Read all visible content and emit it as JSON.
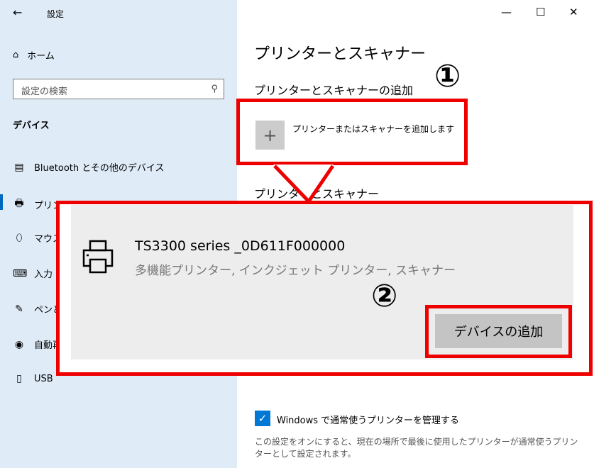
{
  "titlebar": {
    "back_icon": "arrow-left-icon",
    "title": "設定"
  },
  "window": {
    "minimize": "—",
    "maximize": "☐",
    "close": "✕"
  },
  "sidebar": {
    "home": "ホーム",
    "search_placeholder": "設定の検索",
    "section": "デバイス",
    "items": [
      {
        "label": "Bluetooth とその他のデバイス",
        "icon": "bluetooth-devices-icon"
      },
      {
        "label": "プリンターとスキャナー",
        "icon": "printer-icon"
      },
      {
        "label": "マウス",
        "icon": "mouse-icon"
      },
      {
        "label": "入力",
        "icon": "keyboard-icon"
      },
      {
        "label": "ペンと Windows Ink",
        "icon": "pen-icon"
      },
      {
        "label": "自動再生",
        "icon": "autoplay-icon"
      },
      {
        "label": "USB",
        "icon": "usb-icon"
      }
    ]
  },
  "main": {
    "title": "プリンターとスキャナー",
    "add_heading": "プリンターとスキャナーの追加",
    "add_label": "プリンターまたはスキャナーを追加します",
    "list_heading": "プリンターとスキャナー",
    "device": {
      "name": "TS3300 series _0D611F000000",
      "type": "多機能プリンター, インクジェット プリンター, スキャナー",
      "add_button": "デバイスの追加"
    },
    "manage_checkbox": "Windows で通常使うプリンターを管理する",
    "manage_desc": "この設定をオンにすると、現在の場所で最後に使用したプリンターが通常使うプリンターとして設定されます。"
  },
  "annotations": {
    "step1": "①",
    "step2": "②"
  },
  "colors": {
    "callout": "#e00000",
    "accent": "#0078d4",
    "sidebar_bg": "#dfecf8"
  }
}
